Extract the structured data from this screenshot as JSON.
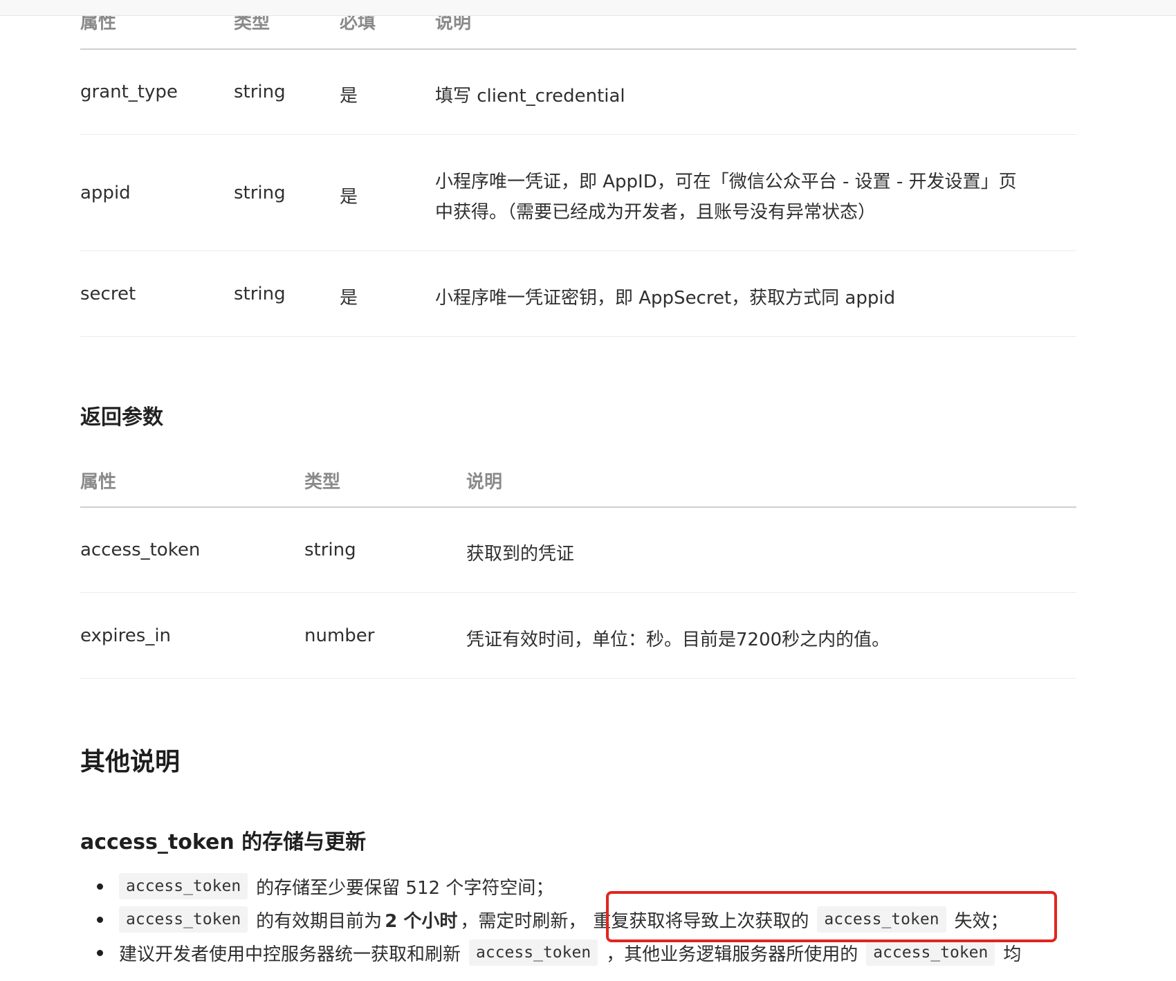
{
  "request_params_table": {
    "headers": [
      "属性",
      "类型",
      "必填",
      "说明"
    ],
    "rows": [
      {
        "name": "grant_type",
        "type": "string",
        "required": "是",
        "desc": "填写 client_credential"
      },
      {
        "name": "appid",
        "type": "string",
        "required": "是",
        "desc_line1": "小程序唯一凭证，即 AppID，可在「微信公众平台 - 设置 - 开发设置」页",
        "desc_line2": "中获得。（需要已经成为开发者，且账号没有异常状态）"
      },
      {
        "name": "secret",
        "type": "string",
        "required": "是",
        "desc": "小程序唯一凭证密钥，即 AppSecret，获取方式同 appid"
      }
    ]
  },
  "return_section": {
    "title": "返回参数",
    "headers": [
      "属性",
      "类型",
      "说明"
    ],
    "rows": [
      {
        "name": "access_token",
        "type": "string",
        "desc": "获取到的凭证"
      },
      {
        "name": "expires_in",
        "type": "number",
        "desc": "凭证有效时间，单位：秒。目前是7200秒之内的值。"
      }
    ]
  },
  "other_section": {
    "title": "其他说明",
    "subtitle": "access_token 的存储与更新",
    "bullets": {
      "b1_code": "access_token",
      "b1_text": "的存储至少要保留 512 个字符空间；",
      "b2_code": "access_token",
      "b2_text_a": "的有效期目前为",
      "b2_bold": "2 个小时",
      "b2_text_b": "，需定时刷新，",
      "b2_highlight_text": "重复获取将导致上次获取的",
      "b2_code2": "access_token",
      "b2_text_c": "失效；",
      "b3_text_a": "建议开发者使用中控服务器统一获取和刷新",
      "b3_code": "access_token",
      "b3_text_b": "，其他业务逻辑服务器所使用的",
      "b3_code2": "access_token",
      "b3_text_c": "均"
    }
  },
  "colors": {
    "highlight_border": "#e0261d",
    "code_bg": "#f3f3f3",
    "header_text": "#8a8a8a"
  }
}
